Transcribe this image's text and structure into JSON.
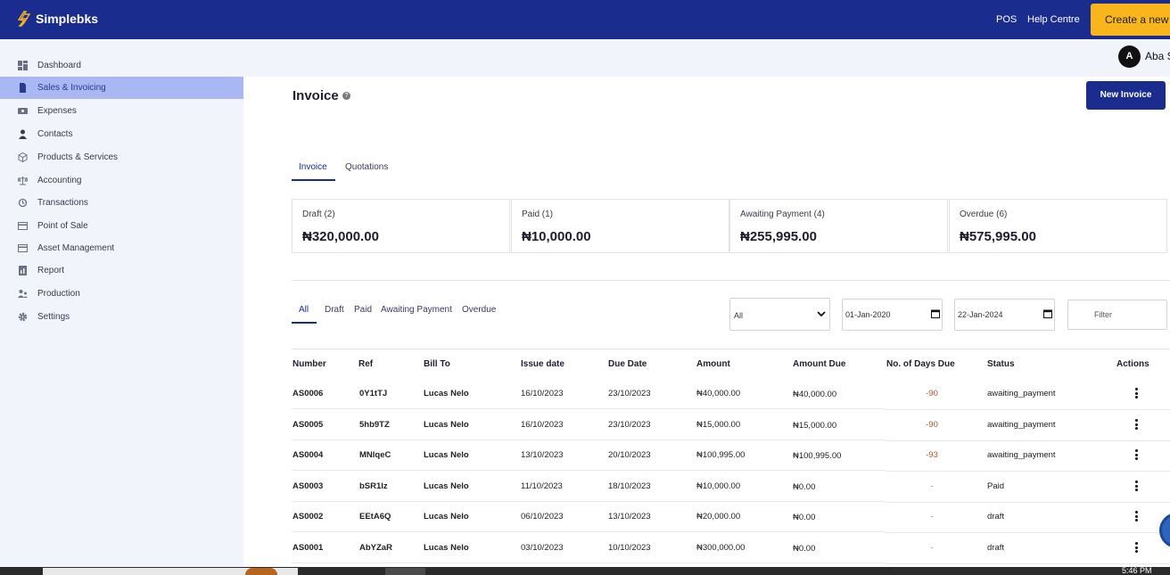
{
  "app": {
    "name": "Simplebks"
  },
  "topbar": {
    "pos": "POS",
    "help": "Help Centre",
    "create": "Create a new"
  },
  "user": {
    "initial": "A",
    "name": "Aba S"
  },
  "sidebar": {
    "items": [
      {
        "label": "Dashboard",
        "icon": "dashboard-icon"
      },
      {
        "label": "Sales & Invoicing",
        "icon": "document-icon",
        "active": true
      },
      {
        "label": "Expenses",
        "icon": "wallet-icon"
      },
      {
        "label": "Contacts",
        "icon": "person-icon"
      },
      {
        "label": "Products & Services",
        "icon": "box-icon"
      },
      {
        "label": "Accounting",
        "icon": "scale-icon"
      },
      {
        "label": "Transactions",
        "icon": "refresh-icon"
      },
      {
        "label": "Point of Sale",
        "icon": "card-icon"
      },
      {
        "label": "Asset Management",
        "icon": "card-icon"
      },
      {
        "label": "Report",
        "icon": "report-icon"
      },
      {
        "label": "Production",
        "icon": "people-icon"
      },
      {
        "label": "Settings",
        "icon": "gear-icon"
      }
    ]
  },
  "main": {
    "title": "Invoice",
    "new_invoice": "New Invoice",
    "tabs": [
      "Invoice",
      "Quotations"
    ],
    "cards": [
      {
        "label": "Draft (2)",
        "value": "₦320,000.00"
      },
      {
        "label": "Paid (1)",
        "value": "₦10,000.00"
      },
      {
        "label": "Awaiting Payment (4)",
        "value": "₦255,995.00"
      },
      {
        "label": "Overdue (6)",
        "value": "₦575,995.00"
      }
    ],
    "filter_tabs": [
      "All",
      "Draft",
      "Paid",
      "Awaiting Payment",
      "Overdue"
    ],
    "status_select": "All",
    "date_from": "01-Jan-2020",
    "date_to": "22-Jan-2024",
    "filter_placeholder": "Filter"
  },
  "table": {
    "headers": [
      "Number",
      "Ref",
      "Bill To",
      "Issue date",
      "Due Date",
      "Amount",
      "Amount Due",
      "No. of Days Due",
      "Status",
      "Actions"
    ],
    "rows": [
      [
        "AS0006",
        "0Y1tTJ",
        "Lucas Nelo",
        "16/10/2023",
        "23/10/2023",
        "₦40,000.00",
        "₦40,000.00",
        "-90",
        "awaiting_payment"
      ],
      [
        "AS0005",
        "5hb9TZ",
        "Lucas Nelo",
        "16/10/2023",
        "23/10/2023",
        "₦15,000.00",
        "₦15,000.00",
        "-90",
        "awaiting_payment"
      ],
      [
        "AS0004",
        "MNlqeC",
        "Lucas Nelo",
        "13/10/2023",
        "20/10/2023",
        "₦100,995.00",
        "₦100,995.00",
        "-93",
        "awaiting_payment"
      ],
      [
        "AS0003",
        "bSR1lz",
        "Lucas Nelo",
        "11/10/2023",
        "18/10/2023",
        "₦10,000.00",
        "₦0.00",
        "-",
        "Paid"
      ],
      [
        "AS0002",
        "EEtA6Q",
        "Lucas Nelo",
        "06/10/2023",
        "13/10/2023",
        "₦20,000.00",
        "₦0.00",
        "-",
        "draft"
      ],
      [
        "AS0001",
        "AbYZaR",
        "Lucas Nelo",
        "03/10/2023",
        "10/10/2023",
        "₦300,000.00",
        "₦0.00",
        "-",
        "draft"
      ]
    ]
  },
  "taskbar": {
    "time": "5:46 PM"
  }
}
